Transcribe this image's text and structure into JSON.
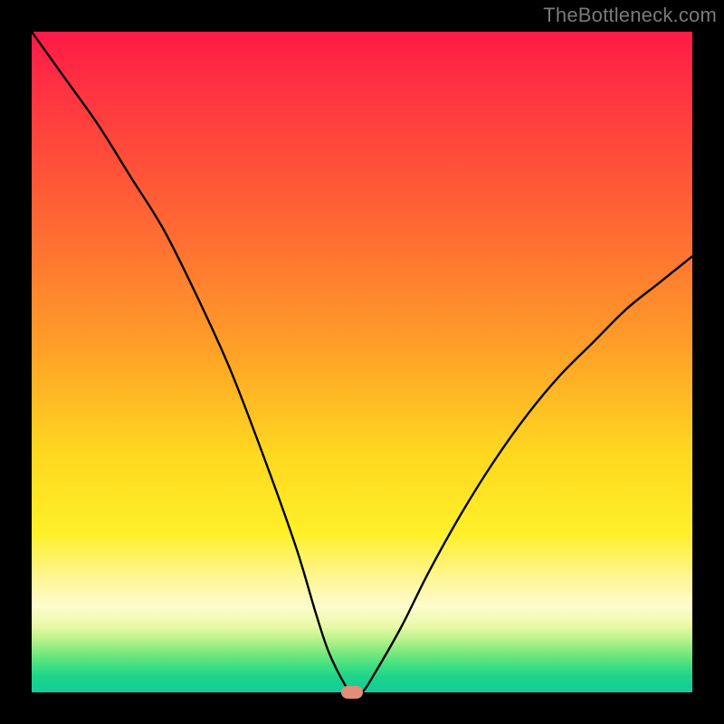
{
  "watermark": "TheBottleneck.com",
  "chart_data": {
    "type": "line",
    "title": "",
    "xlabel": "",
    "ylabel": "",
    "xlim": [
      0,
      100
    ],
    "ylim": [
      0,
      100
    ],
    "grid": false,
    "series": [
      {
        "name": "bottleneck-curve",
        "x": [
          0,
          5,
          10,
          15,
          20,
          25,
          30,
          35,
          40,
          43,
          45,
          47.5,
          48.5,
          50,
          52,
          56,
          60,
          65,
          70,
          75,
          80,
          85,
          90,
          95,
          100
        ],
        "values": [
          100,
          93,
          86,
          78,
          70,
          60,
          49,
          36,
          22,
          12,
          6,
          1,
          0,
          0,
          3,
          10,
          18,
          27,
          35,
          42,
          48,
          53,
          58,
          62,
          66
        ]
      }
    ],
    "marker": {
      "x": 48.5,
      "y": 0
    },
    "background_gradient": {
      "top": "#ff1a47",
      "mid_upper": "#ffa028",
      "mid": "#fff029",
      "mid_lower": "#fdfccd",
      "bottom": "#12cda0"
    }
  }
}
